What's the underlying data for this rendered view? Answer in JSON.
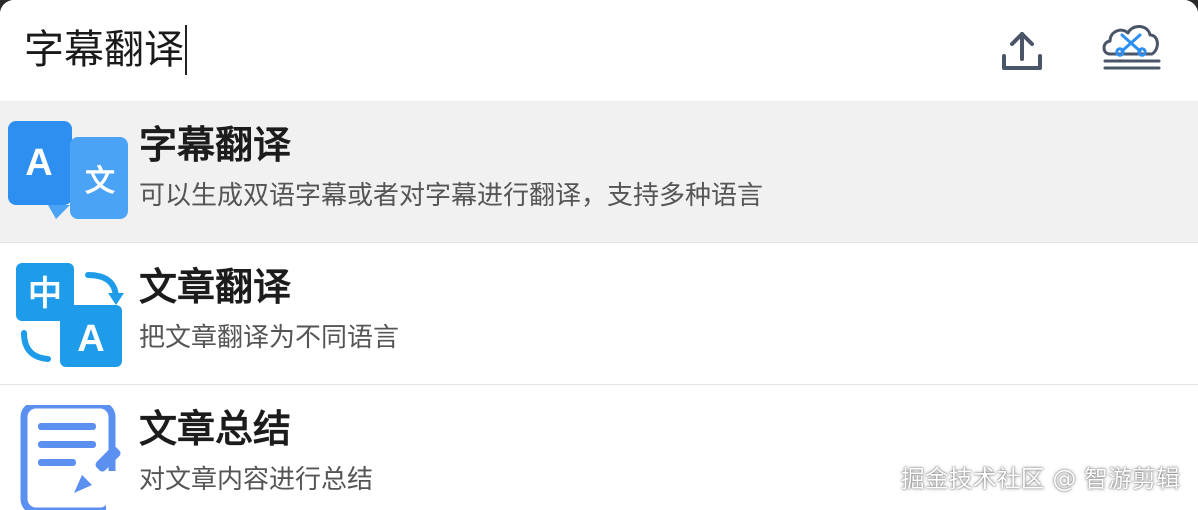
{
  "search": {
    "value": "字幕翻译"
  },
  "toolbar": {
    "upload_icon": "upload-icon",
    "cloud_icon": "cloud-scissors-icon"
  },
  "results": [
    {
      "title": "字幕翻译",
      "description": "可以生成双语字幕或者对字幕进行翻译，支持多种语言",
      "icon": "translate-a-wen-icon",
      "selected": true
    },
    {
      "title": "文章翻译",
      "description": "把文章翻译为不同语言",
      "icon": "translate-zhong-a-icon",
      "selected": false
    },
    {
      "title": "文章总结",
      "description": "对文章内容进行总结",
      "icon": "document-edit-icon",
      "selected": false
    }
  ],
  "watermark": "掘金技术社区 @ 智游剪辑",
  "colors": {
    "accent_blue": "#2d8ff0",
    "icon_blue": "#1e9be9",
    "doc_blue": "#5b8ff0",
    "selected_bg": "#f1f1f1",
    "icon_gray": "#4a5568"
  }
}
